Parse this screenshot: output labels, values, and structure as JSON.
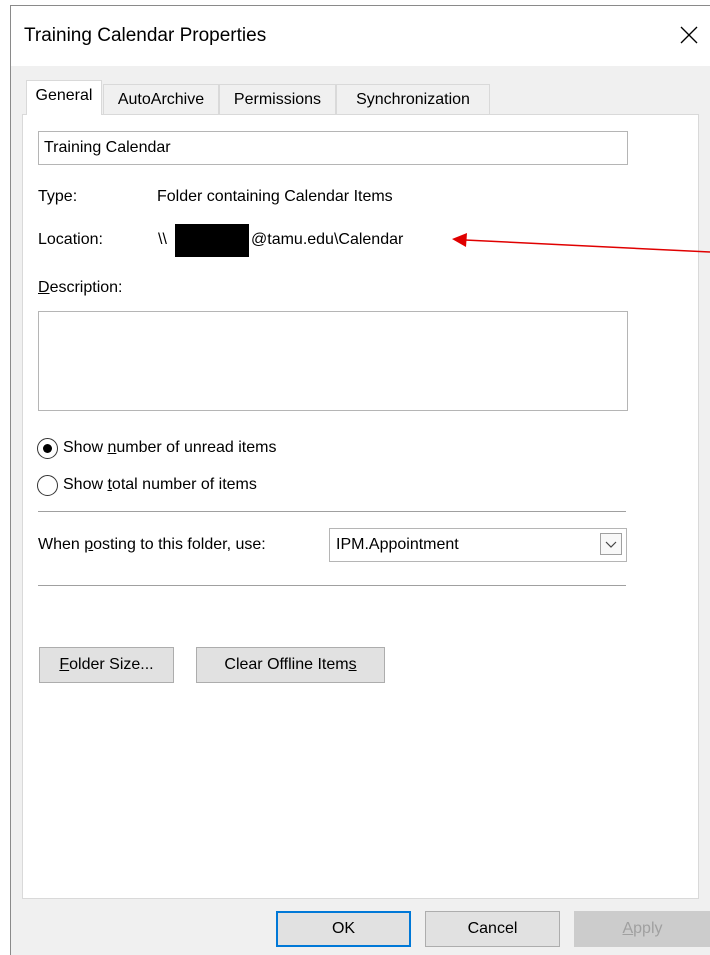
{
  "window": {
    "title": "Training Calendar Properties"
  },
  "tabs": [
    {
      "label": "General",
      "active": true
    },
    {
      "label": "AutoArchive",
      "active": false
    },
    {
      "label": "Permissions",
      "active": false
    },
    {
      "label": "Synchronization",
      "active": false
    }
  ],
  "general": {
    "folder_name": "Training Calendar",
    "type_label": "Type:",
    "type_value": "Folder containing Calendar Items",
    "location_label": "Location:",
    "location_prefix": "\\\\",
    "location_suffix": "@tamu.edu\\Calendar",
    "description_label_key": "D",
    "description_label_rest": "escription:",
    "description_value": "",
    "radio_unread": {
      "pre": "Show ",
      "key": "n",
      "post": "umber of unread items",
      "checked": true
    },
    "radio_total": {
      "pre": "Show ",
      "key": "t",
      "post": "otal number of items",
      "checked": false
    },
    "posting_label_pre": "When ",
    "posting_label_key": "p",
    "posting_label_post": "osting to this folder, use:",
    "posting_value": "IPM.Appointment",
    "folder_size_key": "F",
    "folder_size_rest": "older Size...",
    "clear_offline_pre": "Clear Offline Item",
    "clear_offline_key": "s"
  },
  "footer": {
    "ok": "OK",
    "cancel": "Cancel",
    "apply_key": "A",
    "apply_rest": "pply"
  },
  "colors": {
    "accent": "#0078d7",
    "annotation_arrow": "#e00000"
  }
}
